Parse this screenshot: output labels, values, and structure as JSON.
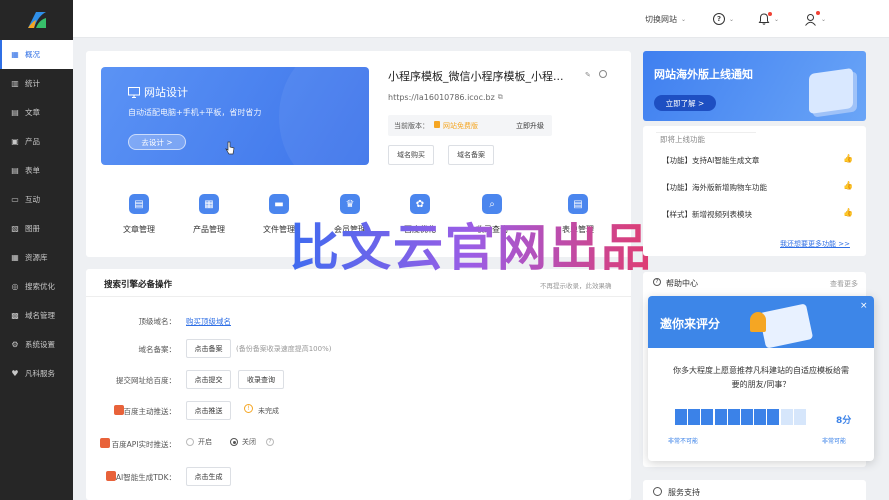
{
  "sidebar": {
    "items": [
      {
        "label": "概况",
        "icon": "dashboard-icon"
      },
      {
        "label": "统计",
        "icon": "chart-icon"
      },
      {
        "label": "文章",
        "icon": "article-icon"
      },
      {
        "label": "产品",
        "icon": "product-icon"
      },
      {
        "label": "表单",
        "icon": "form-icon"
      },
      {
        "label": "互动",
        "icon": "chat-icon"
      },
      {
        "label": "图册",
        "icon": "album-icon"
      },
      {
        "label": "资源库",
        "icon": "resource-icon"
      },
      {
        "label": "搜索优化",
        "icon": "search-icon"
      },
      {
        "label": "域名管理",
        "icon": "domain-icon"
      },
      {
        "label": "系统设置",
        "icon": "settings-icon"
      },
      {
        "label": "凡科服务",
        "icon": "service-icon"
      }
    ]
  },
  "topbar": {
    "switch_site": "切换网站"
  },
  "banner": {
    "title": "网站设计",
    "subtitle": "自动适配电脑+手机+平板，省时省力",
    "button": "去设计 >"
  },
  "site": {
    "name": "小程序模板_微信小程序模板_小程...",
    "url": "https://la16010786.icoc.bz",
    "version_label": "当前版本：",
    "version_value": "网站免费版",
    "upgrade": "立即升级",
    "domain_btn": "域名购买",
    "record_btn": "域名备案"
  },
  "quick_actions": [
    {
      "label": "文章管理",
      "icon": "article-icon"
    },
    {
      "label": "产品管理",
      "icon": "product-icon"
    },
    {
      "label": "文件管理",
      "icon": "folder-icon"
    },
    {
      "label": "会员管理",
      "icon": "member-icon"
    },
    {
      "label": "百度优化",
      "icon": "baidu-paw-icon"
    },
    {
      "label": "收录查询",
      "icon": "index-query-icon"
    },
    {
      "label": "表单管理",
      "icon": "form-icon"
    }
  ],
  "watermark": "比文云官网出品",
  "seo": {
    "title": "搜索引擎必备操作",
    "close_text": "不再提示收录，此效果确",
    "rows": [
      {
        "label": "顶级域名：",
        "link": "购买顶级域名"
      },
      {
        "label": "域名备案：",
        "button": "点击备案",
        "note": "(备份备案收录速度提高100%)"
      },
      {
        "label": "提交网址给百度：",
        "button": "点击提交",
        "button2": "收录查询"
      },
      {
        "label": "百度主动推送：",
        "button": "点击推送",
        "status": "未完成"
      },
      {
        "label": "百度API实时推送：",
        "opt1": "开启",
        "opt2": "关闭"
      },
      {
        "label": "AI智能生成TDK：",
        "button": "点击生成"
      }
    ]
  },
  "promo": {
    "title": "网站海外版上线通知",
    "button": "立即了解 >"
  },
  "updates": {
    "title": "即将上线功能",
    "items": [
      "【功能】支持AI智能生成文章",
      "【功能】海外版新增购物车功能",
      "【样式】新增视频列表模块"
    ],
    "more": "我还想要更多功能 >>"
  },
  "help": {
    "title": "帮助中心",
    "more": "查看更多"
  },
  "rating": {
    "title": "邀你来评分",
    "question": "你多大程度上愿意推荐凡科建站的自适应模板给需要的朋友/同事？",
    "score": "8分",
    "score_value": 8,
    "max": 10,
    "low_label": "非常不可能",
    "high_label": "非常可能"
  },
  "service": {
    "title": "服务支持"
  },
  "colors": {
    "accent": "#2f6fe5",
    "sidebar": "#262626",
    "banner": "#4a84f0"
  }
}
